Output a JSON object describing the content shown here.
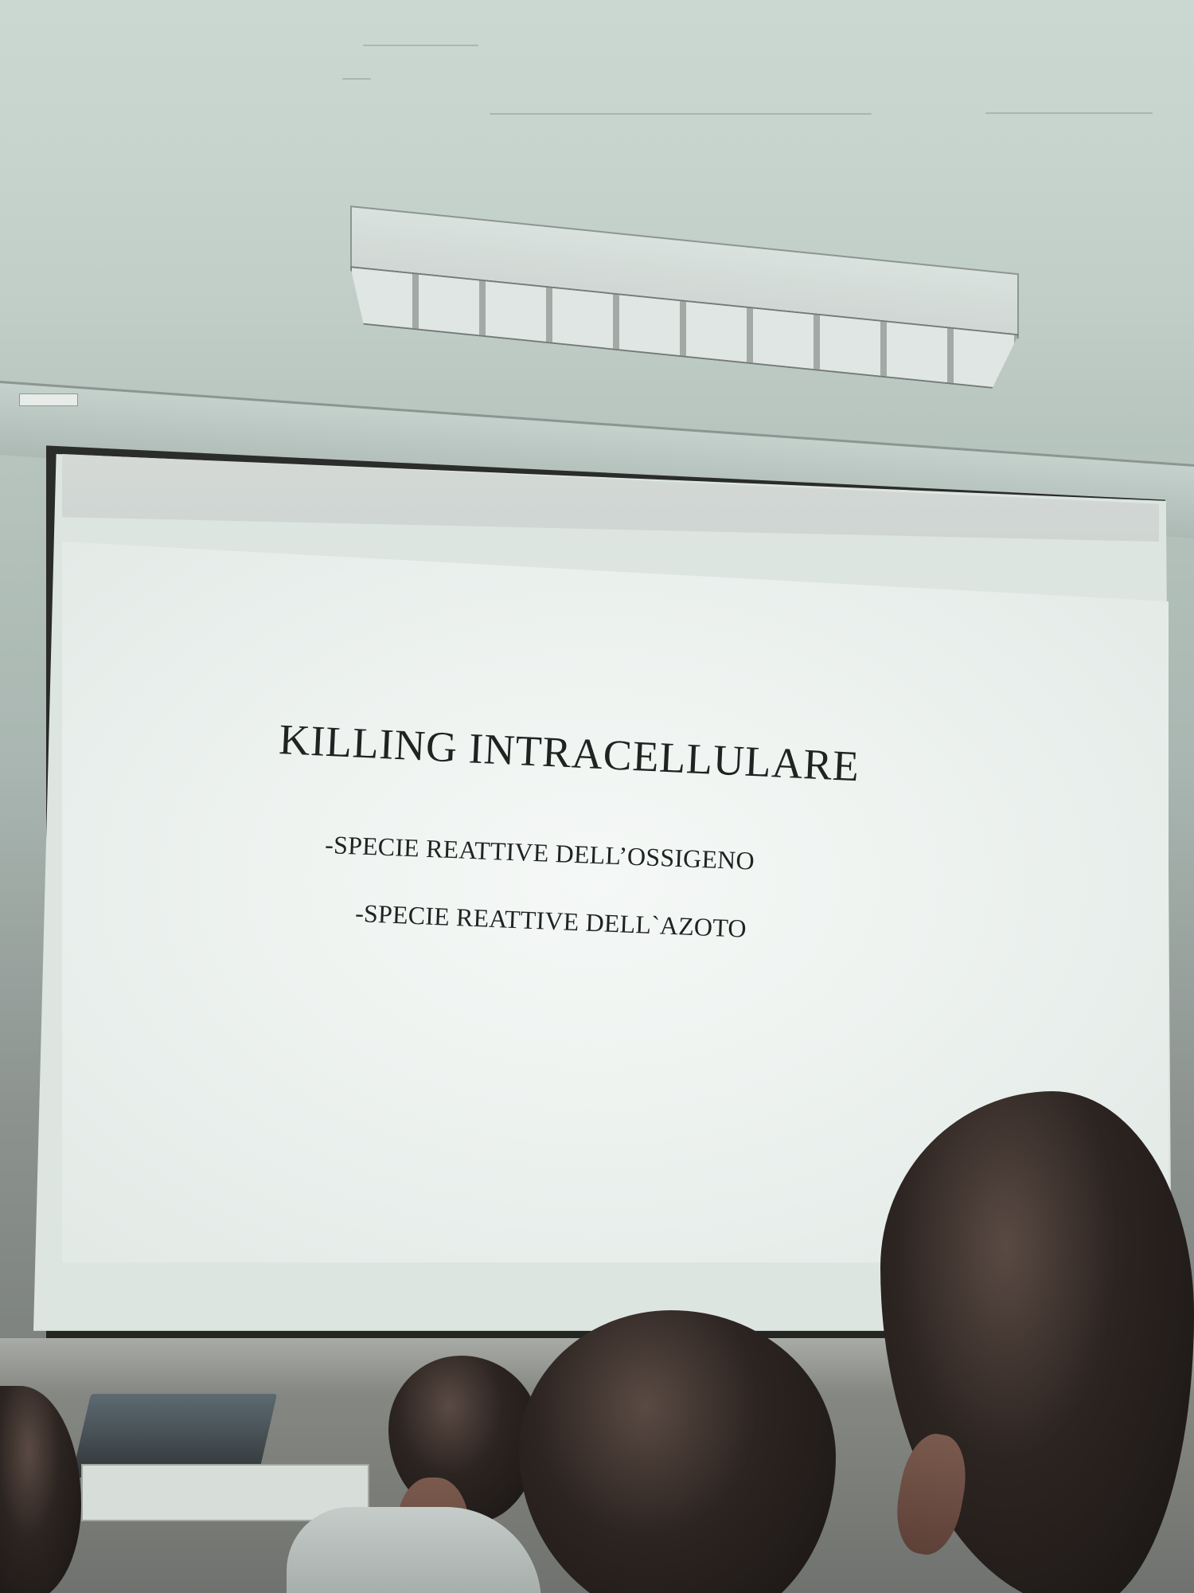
{
  "slide": {
    "title": "KILLING INTRACELLULARE",
    "items": [
      "-SPECIE  REATTIVE DELL’OSSIGENO",
      "-SPECIE REATTIVE DELL`AZOTO"
    ]
  }
}
